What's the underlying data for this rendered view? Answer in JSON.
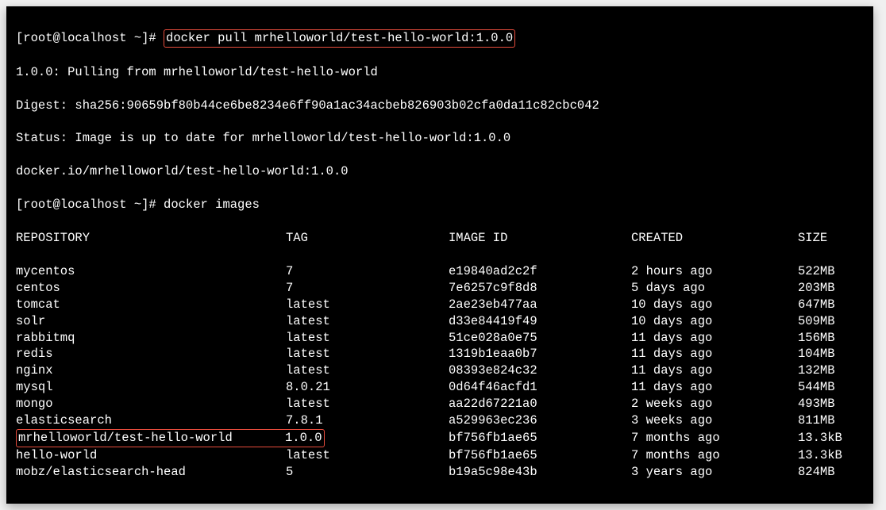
{
  "prompt1": "[root@localhost ~]# ",
  "cmd1": "docker pull mrhelloworld/test-hello-world:1.0.0",
  "out1_line1": "1.0.0: Pulling from mrhelloworld/test-hello-world",
  "out1_line2": "Digest: sha256:90659bf80b44ce6be8234e6ff90a1ac34acbeb826903b02cfa0da11c82cbc042",
  "out1_line3": "Status: Image is up to date for mrhelloworld/test-hello-world:1.0.0",
  "out1_line4": "docker.io/mrhelloworld/test-hello-world:1.0.0",
  "prompt2": "[root@localhost ~]# ",
  "cmd2": "docker images",
  "headers": {
    "repo": "REPOSITORY",
    "tag": "TAG",
    "image": "IMAGE ID",
    "created": "CREATED",
    "size": "SIZE"
  },
  "images": [
    {
      "repo": "mycentos",
      "tag": "7",
      "image": "e19840ad2c2f",
      "created": "2 hours ago",
      "size": "522MB"
    },
    {
      "repo": "centos",
      "tag": "7",
      "image": "7e6257c9f8d8",
      "created": "5 days ago",
      "size": "203MB"
    },
    {
      "repo": "tomcat",
      "tag": "latest",
      "image": "2ae23eb477aa",
      "created": "10 days ago",
      "size": "647MB"
    },
    {
      "repo": "solr",
      "tag": "latest",
      "image": "d33e84419f49",
      "created": "10 days ago",
      "size": "509MB"
    },
    {
      "repo": "rabbitmq",
      "tag": "latest",
      "image": "51ce028a0e75",
      "created": "11 days ago",
      "size": "156MB"
    },
    {
      "repo": "redis",
      "tag": "latest",
      "image": "1319b1eaa0b7",
      "created": "11 days ago",
      "size": "104MB"
    },
    {
      "repo": "nginx",
      "tag": "latest",
      "image": "08393e824c32",
      "created": "11 days ago",
      "size": "132MB"
    },
    {
      "repo": "mysql",
      "tag": "8.0.21",
      "image": "0d64f46acfd1",
      "created": "11 days ago",
      "size": "544MB"
    },
    {
      "repo": "mongo",
      "tag": "latest",
      "image": "aa22d67221a0",
      "created": "2 weeks ago",
      "size": "493MB"
    },
    {
      "repo": "elasticsearch",
      "tag": "7.8.1",
      "image": "a529963ec236",
      "created": "3 weeks ago",
      "size": "811MB"
    },
    {
      "repo": "mrhelloworld/test-hello-world",
      "tag": "1.0.0",
      "image": "bf756fb1ae65",
      "created": "7 months ago",
      "size": "13.3kB",
      "highlight": true
    },
    {
      "repo": "hello-world",
      "tag": "latest",
      "image": "bf756fb1ae65",
      "created": "7 months ago",
      "size": "13.3kB"
    },
    {
      "repo": "mobz/elasticsearch-head",
      "tag": "5",
      "image": "b19a5c98e43b",
      "created": "3 years ago",
      "size": "824MB"
    }
  ]
}
